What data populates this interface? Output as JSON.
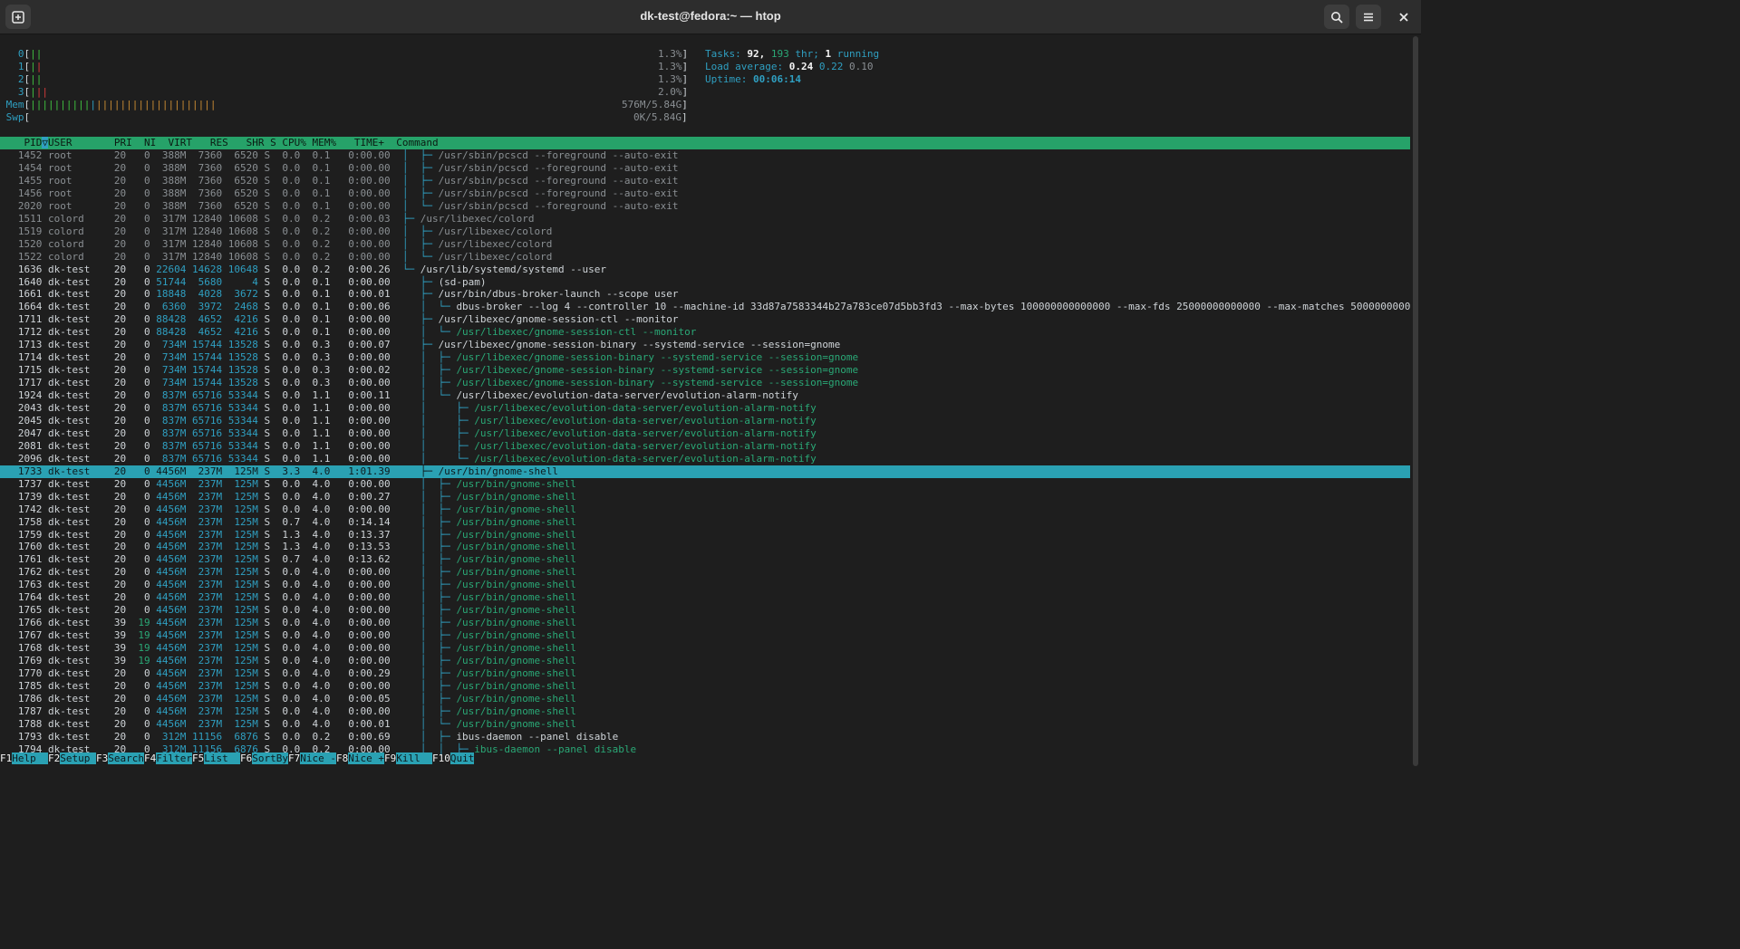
{
  "window": {
    "title": "dk-test@fedora:~ — htop",
    "new_tab_icon": "new-tab-icon",
    "search_icon": "search-icon",
    "menu_icon": "hamburger-menu-icon",
    "close_icon": "close-icon"
  },
  "meters": {
    "cpus": [
      {
        "label": "0",
        "bars": "||",
        "value": "1.3%"
      },
      {
        "label": "1",
        "bars": "||",
        "value": "1.3%"
      },
      {
        "label": "2",
        "bars": "||",
        "value": "1.3%"
      },
      {
        "label": "3",
        "bars": "|||",
        "value": "2.0%"
      }
    ],
    "mem": {
      "label": "Mem",
      "value": "576M/5.84G"
    },
    "swp": {
      "label": "Swp",
      "value": "0K/5.84G"
    },
    "tasks_label": "Tasks:",
    "tasks": "92,",
    "threads": "193",
    "threads_label": "thr;",
    "running": "1",
    "running_label": "running",
    "load_label": "Load average:",
    "load1": "0.24",
    "load5": "0.22",
    "load15": "0.10",
    "uptime_label": "Uptime:",
    "uptime": "00:06:14"
  },
  "header": {
    "pid": "PID",
    "sort_indicator": "▽",
    "user": "USER",
    "pri": "PRI",
    "ni": "NI",
    "virt": "VIRT",
    "res": "RES",
    "shr": "SHR",
    "s": "S",
    "cpu": "CPU%",
    "mem": "MEM%",
    "time": "TIME+",
    "command": "Command"
  },
  "processes": [
    {
      "pid": "1452",
      "user": "root",
      "pri": "20",
      "ni": "0",
      "virt": "388M",
      "res": "7360",
      "shr": "6520",
      "s": "S",
      "cpu": "0.0",
      "mem": "0.1",
      "time": "0:00.00",
      "tree": "│  ├─ ",
      "cmd": "/usr/sbin/pcscd --foreground --auto-exit",
      "style": "grey"
    },
    {
      "pid": "1454",
      "user": "root",
      "pri": "20",
      "ni": "0",
      "virt": "388M",
      "res": "7360",
      "shr": "6520",
      "s": "S",
      "cpu": "0.0",
      "mem": "0.1",
      "time": "0:00.00",
      "tree": "│  ├─ ",
      "cmd": "/usr/sbin/pcscd --foreground --auto-exit",
      "style": "grey"
    },
    {
      "pid": "1455",
      "user": "root",
      "pri": "20",
      "ni": "0",
      "virt": "388M",
      "res": "7360",
      "shr": "6520",
      "s": "S",
      "cpu": "0.0",
      "mem": "0.1",
      "time": "0:00.00",
      "tree": "│  ├─ ",
      "cmd": "/usr/sbin/pcscd --foreground --auto-exit",
      "style": "grey"
    },
    {
      "pid": "1456",
      "user": "root",
      "pri": "20",
      "ni": "0",
      "virt": "388M",
      "res": "7360",
      "shr": "6520",
      "s": "S",
      "cpu": "0.0",
      "mem": "0.1",
      "time": "0:00.00",
      "tree": "│  ├─ ",
      "cmd": "/usr/sbin/pcscd --foreground --auto-exit",
      "style": "grey"
    },
    {
      "pid": "2020",
      "user": "root",
      "pri": "20",
      "ni": "0",
      "virt": "388M",
      "res": "7360",
      "shr": "6520",
      "s": "S",
      "cpu": "0.0",
      "mem": "0.1",
      "time": "0:00.00",
      "tree": "│  └─ ",
      "cmd": "/usr/sbin/pcscd --foreground --auto-exit",
      "style": "grey"
    },
    {
      "pid": "1511",
      "user": "colord",
      "pri": "20",
      "ni": "0",
      "virt": "317M",
      "res": "12840",
      "shr": "10608",
      "s": "S",
      "cpu": "0.0",
      "mem": "0.2",
      "time": "0:00.03",
      "tree": "├─ ",
      "cmd": "/usr/libexec/colord",
      "style": "grey"
    },
    {
      "pid": "1519",
      "user": "colord",
      "pri": "20",
      "ni": "0",
      "virt": "317M",
      "res": "12840",
      "shr": "10608",
      "s": "S",
      "cpu": "0.0",
      "mem": "0.2",
      "time": "0:00.00",
      "tree": "│  ├─ ",
      "cmd": "/usr/libexec/colord",
      "style": "grey"
    },
    {
      "pid": "1520",
      "user": "colord",
      "pri": "20",
      "ni": "0",
      "virt": "317M",
      "res": "12840",
      "shr": "10608",
      "s": "S",
      "cpu": "0.0",
      "mem": "0.2",
      "time": "0:00.00",
      "tree": "│  ├─ ",
      "cmd": "/usr/libexec/colord",
      "style": "grey"
    },
    {
      "pid": "1522",
      "user": "colord",
      "pri": "20",
      "ni": "0",
      "virt": "317M",
      "res": "12840",
      "shr": "10608",
      "s": "S",
      "cpu": "0.0",
      "mem": "0.2",
      "time": "0:00.00",
      "tree": "│  └─ ",
      "cmd": "/usr/libexec/colord",
      "style": "grey"
    },
    {
      "pid": "1636",
      "user": "dk-test",
      "pri": "20",
      "ni": "0",
      "virt": "22604",
      "res": "14628",
      "shr": "10648",
      "s": "S",
      "cpu": "0.0",
      "mem": "0.2",
      "time": "0:00.26",
      "tree": "└─ ",
      "cmd": "/usr/lib/systemd/systemd --user",
      "style": "normal"
    },
    {
      "pid": "1640",
      "user": "dk-test",
      "pri": "20",
      "ni": "0",
      "virt": "51744",
      "res": "5680",
      "shr": "4",
      "s": "S",
      "cpu": "0.0",
      "mem": "0.1",
      "time": "0:00.00",
      "tree": "   ├─ ",
      "cmd": "(sd-pam)",
      "style": "normal"
    },
    {
      "pid": "1661",
      "user": "dk-test",
      "pri": "20",
      "ni": "0",
      "virt": "18848",
      "res": "4028",
      "shr": "3672",
      "s": "S",
      "cpu": "0.0",
      "mem": "0.1",
      "time": "0:00.01",
      "tree": "   ├─ ",
      "cmd": "/usr/bin/dbus-broker-launch --scope user",
      "style": "normal"
    },
    {
      "pid": "1664",
      "user": "dk-test",
      "pri": "20",
      "ni": "0",
      "virt": "6360",
      "res": "3972",
      "shr": "2468",
      "s": "S",
      "cpu": "0.0",
      "mem": "0.1",
      "time": "0:00.06",
      "tree": "   │  └─ ",
      "cmd": "dbus-broker --log 4 --controller 10 --machine-id 33d87a7583344b27a783ce07d5bb3fd3 --max-bytes 100000000000000 --max-fds 25000000000000 --max-matches 5000000000",
      "style": "normal"
    },
    {
      "pid": "1711",
      "user": "dk-test",
      "pri": "20",
      "ni": "0",
      "virt": "88428",
      "res": "4652",
      "shr": "4216",
      "s": "S",
      "cpu": "0.0",
      "mem": "0.1",
      "time": "0:00.00",
      "tree": "   ├─ ",
      "cmd": "/usr/libexec/gnome-session-ctl --monitor",
      "style": "normal"
    },
    {
      "pid": "1712",
      "user": "dk-test",
      "pri": "20",
      "ni": "0",
      "virt": "88428",
      "res": "4652",
      "shr": "4216",
      "s": "S",
      "cpu": "0.0",
      "mem": "0.1",
      "time": "0:00.00",
      "tree": "   │  └─ ",
      "cmd": "/usr/libexec/gnome-session-ctl --monitor",
      "style": "thread"
    },
    {
      "pid": "1713",
      "user": "dk-test",
      "pri": "20",
      "ni": "0",
      "virt": "734M",
      "res": "15744",
      "shr": "13528",
      "s": "S",
      "cpu": "0.0",
      "mem": "0.3",
      "time": "0:00.07",
      "tree": "   ├─ ",
      "cmd": "/usr/libexec/gnome-session-binary --systemd-service --session=gnome",
      "style": "normal"
    },
    {
      "pid": "1714",
      "user": "dk-test",
      "pri": "20",
      "ni": "0",
      "virt": "734M",
      "res": "15744",
      "shr": "13528",
      "s": "S",
      "cpu": "0.0",
      "mem": "0.3",
      "time": "0:00.00",
      "tree": "   │  ├─ ",
      "cmd": "/usr/libexec/gnome-session-binary --systemd-service --session=gnome",
      "style": "thread"
    },
    {
      "pid": "1715",
      "user": "dk-test",
      "pri": "20",
      "ni": "0",
      "virt": "734M",
      "res": "15744",
      "shr": "13528",
      "s": "S",
      "cpu": "0.0",
      "mem": "0.3",
      "time": "0:00.02",
      "tree": "   │  ├─ ",
      "cmd": "/usr/libexec/gnome-session-binary --systemd-service --session=gnome",
      "style": "thread"
    },
    {
      "pid": "1717",
      "user": "dk-test",
      "pri": "20",
      "ni": "0",
      "virt": "734M",
      "res": "15744",
      "shr": "13528",
      "s": "S",
      "cpu": "0.0",
      "mem": "0.3",
      "time": "0:00.00",
      "tree": "   │  ├─ ",
      "cmd": "/usr/libexec/gnome-session-binary --systemd-service --session=gnome",
      "style": "thread"
    },
    {
      "pid": "1924",
      "user": "dk-test",
      "pri": "20",
      "ni": "0",
      "virt": "837M",
      "res": "65716",
      "shr": "53344",
      "s": "S",
      "cpu": "0.0",
      "mem": "1.1",
      "time": "0:00.11",
      "tree": "   │  └─ ",
      "cmd": "/usr/libexec/evolution-data-server/evolution-alarm-notify",
      "style": "normal"
    },
    {
      "pid": "2043",
      "user": "dk-test",
      "pri": "20",
      "ni": "0",
      "virt": "837M",
      "res": "65716",
      "shr": "53344",
      "s": "S",
      "cpu": "0.0",
      "mem": "1.1",
      "time": "0:00.00",
      "tree": "   │     ├─ ",
      "cmd": "/usr/libexec/evolution-data-server/evolution-alarm-notify",
      "style": "thread"
    },
    {
      "pid": "2045",
      "user": "dk-test",
      "pri": "20",
      "ni": "0",
      "virt": "837M",
      "res": "65716",
      "shr": "53344",
      "s": "S",
      "cpu": "0.0",
      "mem": "1.1",
      "time": "0:00.00",
      "tree": "   │     ├─ ",
      "cmd": "/usr/libexec/evolution-data-server/evolution-alarm-notify",
      "style": "thread"
    },
    {
      "pid": "2047",
      "user": "dk-test",
      "pri": "20",
      "ni": "0",
      "virt": "837M",
      "res": "65716",
      "shr": "53344",
      "s": "S",
      "cpu": "0.0",
      "mem": "1.1",
      "time": "0:00.00",
      "tree": "   │     ├─ ",
      "cmd": "/usr/libexec/evolution-data-server/evolution-alarm-notify",
      "style": "thread"
    },
    {
      "pid": "2081",
      "user": "dk-test",
      "pri": "20",
      "ni": "0",
      "virt": "837M",
      "res": "65716",
      "shr": "53344",
      "s": "S",
      "cpu": "0.0",
      "mem": "1.1",
      "time": "0:00.00",
      "tree": "   │     ├─ ",
      "cmd": "/usr/libexec/evolution-data-server/evolution-alarm-notify",
      "style": "thread"
    },
    {
      "pid": "2096",
      "user": "dk-test",
      "pri": "20",
      "ni": "0",
      "virt": "837M",
      "res": "65716",
      "shr": "53344",
      "s": "S",
      "cpu": "0.0",
      "mem": "1.1",
      "time": "0:00.00",
      "tree": "   │     └─ ",
      "cmd": "/usr/libexec/evolution-data-server/evolution-alarm-notify",
      "style": "thread"
    },
    {
      "pid": "1733",
      "user": "dk-test",
      "pri": "20",
      "ni": "0",
      "virt": "4456M",
      "res": "237M",
      "shr": "125M",
      "s": "S",
      "cpu": "3.3",
      "mem": "4.0",
      "time": "1:01.39",
      "tree": "   ├─ ",
      "cmd": "/usr/bin/gnome-shell",
      "style": "selected"
    },
    {
      "pid": "1737",
      "user": "dk-test",
      "pri": "20",
      "ni": "0",
      "virt": "4456M",
      "res": "237M",
      "shr": "125M",
      "s": "S",
      "cpu": "0.0",
      "mem": "4.0",
      "time": "0:00.00",
      "tree": "   │  ├─ ",
      "cmd": "/usr/bin/gnome-shell",
      "style": "thread"
    },
    {
      "pid": "1739",
      "user": "dk-test",
      "pri": "20",
      "ni": "0",
      "virt": "4456M",
      "res": "237M",
      "shr": "125M",
      "s": "S",
      "cpu": "0.0",
      "mem": "4.0",
      "time": "0:00.27",
      "tree": "   │  ├─ ",
      "cmd": "/usr/bin/gnome-shell",
      "style": "thread"
    },
    {
      "pid": "1742",
      "user": "dk-test",
      "pri": "20",
      "ni": "0",
      "virt": "4456M",
      "res": "237M",
      "shr": "125M",
      "s": "S",
      "cpu": "0.0",
      "mem": "4.0",
      "time": "0:00.00",
      "tree": "   │  ├─ ",
      "cmd": "/usr/bin/gnome-shell",
      "style": "thread"
    },
    {
      "pid": "1758",
      "user": "dk-test",
      "pri": "20",
      "ni": "0",
      "virt": "4456M",
      "res": "237M",
      "shr": "125M",
      "s": "S",
      "cpu": "0.7",
      "mem": "4.0",
      "time": "0:14.14",
      "tree": "   │  ├─ ",
      "cmd": "/usr/bin/gnome-shell",
      "style": "thread"
    },
    {
      "pid": "1759",
      "user": "dk-test",
      "pri": "20",
      "ni": "0",
      "virt": "4456M",
      "res": "237M",
      "shr": "125M",
      "s": "S",
      "cpu": "1.3",
      "mem": "4.0",
      "time": "0:13.37",
      "tree": "   │  ├─ ",
      "cmd": "/usr/bin/gnome-shell",
      "style": "thread"
    },
    {
      "pid": "1760",
      "user": "dk-test",
      "pri": "20",
      "ni": "0",
      "virt": "4456M",
      "res": "237M",
      "shr": "125M",
      "s": "S",
      "cpu": "1.3",
      "mem": "4.0",
      "time": "0:13.53",
      "tree": "   │  ├─ ",
      "cmd": "/usr/bin/gnome-shell",
      "style": "thread"
    },
    {
      "pid": "1761",
      "user": "dk-test",
      "pri": "20",
      "ni": "0",
      "virt": "4456M",
      "res": "237M",
      "shr": "125M",
      "s": "S",
      "cpu": "0.7",
      "mem": "4.0",
      "time": "0:13.62",
      "tree": "   │  ├─ ",
      "cmd": "/usr/bin/gnome-shell",
      "style": "thread"
    },
    {
      "pid": "1762",
      "user": "dk-test",
      "pri": "20",
      "ni": "0",
      "virt": "4456M",
      "res": "237M",
      "shr": "125M",
      "s": "S",
      "cpu": "0.0",
      "mem": "4.0",
      "time": "0:00.00",
      "tree": "   │  ├─ ",
      "cmd": "/usr/bin/gnome-shell",
      "style": "thread"
    },
    {
      "pid": "1763",
      "user": "dk-test",
      "pri": "20",
      "ni": "0",
      "virt": "4456M",
      "res": "237M",
      "shr": "125M",
      "s": "S",
      "cpu": "0.0",
      "mem": "4.0",
      "time": "0:00.00",
      "tree": "   │  ├─ ",
      "cmd": "/usr/bin/gnome-shell",
      "style": "thread"
    },
    {
      "pid": "1764",
      "user": "dk-test",
      "pri": "20",
      "ni": "0",
      "virt": "4456M",
      "res": "237M",
      "shr": "125M",
      "s": "S",
      "cpu": "0.0",
      "mem": "4.0",
      "time": "0:00.00",
      "tree": "   │  ├─ ",
      "cmd": "/usr/bin/gnome-shell",
      "style": "thread"
    },
    {
      "pid": "1765",
      "user": "dk-test",
      "pri": "20",
      "ni": "0",
      "virt": "4456M",
      "res": "237M",
      "shr": "125M",
      "s": "S",
      "cpu": "0.0",
      "mem": "4.0",
      "time": "0:00.00",
      "tree": "   │  ├─ ",
      "cmd": "/usr/bin/gnome-shell",
      "style": "thread"
    },
    {
      "pid": "1766",
      "user": "dk-test",
      "pri": "39",
      "ni": "19",
      "virt": "4456M",
      "res": "237M",
      "shr": "125M",
      "s": "S",
      "cpu": "0.0",
      "mem": "4.0",
      "time": "0:00.00",
      "tree": "   │  ├─ ",
      "cmd": "/usr/bin/gnome-shell",
      "style": "thread"
    },
    {
      "pid": "1767",
      "user": "dk-test",
      "pri": "39",
      "ni": "19",
      "virt": "4456M",
      "res": "237M",
      "shr": "125M",
      "s": "S",
      "cpu": "0.0",
      "mem": "4.0",
      "time": "0:00.00",
      "tree": "   │  ├─ ",
      "cmd": "/usr/bin/gnome-shell",
      "style": "thread"
    },
    {
      "pid": "1768",
      "user": "dk-test",
      "pri": "39",
      "ni": "19",
      "virt": "4456M",
      "res": "237M",
      "shr": "125M",
      "s": "S",
      "cpu": "0.0",
      "mem": "4.0",
      "time": "0:00.00",
      "tree": "   │  ├─ ",
      "cmd": "/usr/bin/gnome-shell",
      "style": "thread"
    },
    {
      "pid": "1769",
      "user": "dk-test",
      "pri": "39",
      "ni": "19",
      "virt": "4456M",
      "res": "237M",
      "shr": "125M",
      "s": "S",
      "cpu": "0.0",
      "mem": "4.0",
      "time": "0:00.00",
      "tree": "   │  ├─ ",
      "cmd": "/usr/bin/gnome-shell",
      "style": "thread"
    },
    {
      "pid": "1770",
      "user": "dk-test",
      "pri": "20",
      "ni": "0",
      "virt": "4456M",
      "res": "237M",
      "shr": "125M",
      "s": "S",
      "cpu": "0.0",
      "mem": "4.0",
      "time": "0:00.29",
      "tree": "   │  ├─ ",
      "cmd": "/usr/bin/gnome-shell",
      "style": "thread"
    },
    {
      "pid": "1785",
      "user": "dk-test",
      "pri": "20",
      "ni": "0",
      "virt": "4456M",
      "res": "237M",
      "shr": "125M",
      "s": "S",
      "cpu": "0.0",
      "mem": "4.0",
      "time": "0:00.00",
      "tree": "   │  ├─ ",
      "cmd": "/usr/bin/gnome-shell",
      "style": "thread"
    },
    {
      "pid": "1786",
      "user": "dk-test",
      "pri": "20",
      "ni": "0",
      "virt": "4456M",
      "res": "237M",
      "shr": "125M",
      "s": "S",
      "cpu": "0.0",
      "mem": "4.0",
      "time": "0:00.05",
      "tree": "   │  ├─ ",
      "cmd": "/usr/bin/gnome-shell",
      "style": "thread"
    },
    {
      "pid": "1787",
      "user": "dk-test",
      "pri": "20",
      "ni": "0",
      "virt": "4456M",
      "res": "237M",
      "shr": "125M",
      "s": "S",
      "cpu": "0.0",
      "mem": "4.0",
      "time": "0:00.00",
      "tree": "   │  ├─ ",
      "cmd": "/usr/bin/gnome-shell",
      "style": "thread"
    },
    {
      "pid": "1788",
      "user": "dk-test",
      "pri": "20",
      "ni": "0",
      "virt": "4456M",
      "res": "237M",
      "shr": "125M",
      "s": "S",
      "cpu": "0.0",
      "mem": "4.0",
      "time": "0:00.01",
      "tree": "   │  └─ ",
      "cmd": "/usr/bin/gnome-shell",
      "style": "thread"
    },
    {
      "pid": "1793",
      "user": "dk-test",
      "pri": "20",
      "ni": "0",
      "virt": "312M",
      "res": "11156",
      "shr": "6876",
      "s": "S",
      "cpu": "0.0",
      "mem": "0.2",
      "time": "0:00.69",
      "tree": "   │  ├─ ",
      "cmd": "ibus-daemon --panel disable",
      "style": "normal"
    },
    {
      "pid": "1794",
      "user": "dk-test",
      "pri": "20",
      "ni": "0",
      "virt": "312M",
      "res": "11156",
      "shr": "6876",
      "s": "S",
      "cpu": "0.0",
      "mem": "0.2",
      "time": "0:00.00",
      "tree": "   │  │  ├─ ",
      "cmd": "ibus-daemon --panel disable",
      "style": "thread"
    }
  ],
  "function_keys": [
    {
      "key": "F1",
      "label": "Help  "
    },
    {
      "key": "F2",
      "label": "Setup "
    },
    {
      "key": "F3",
      "label": "Search"
    },
    {
      "key": "F4",
      "label": "Filter"
    },
    {
      "key": "F5",
      "label": "List  "
    },
    {
      "key": "F6",
      "label": "SortBy"
    },
    {
      "key": "F7",
      "label": "Nice -"
    },
    {
      "key": "F8",
      "label": "Nice +"
    },
    {
      "key": "F9",
      "label": "Kill  "
    },
    {
      "key": "F10",
      "label": "Quit"
    }
  ]
}
